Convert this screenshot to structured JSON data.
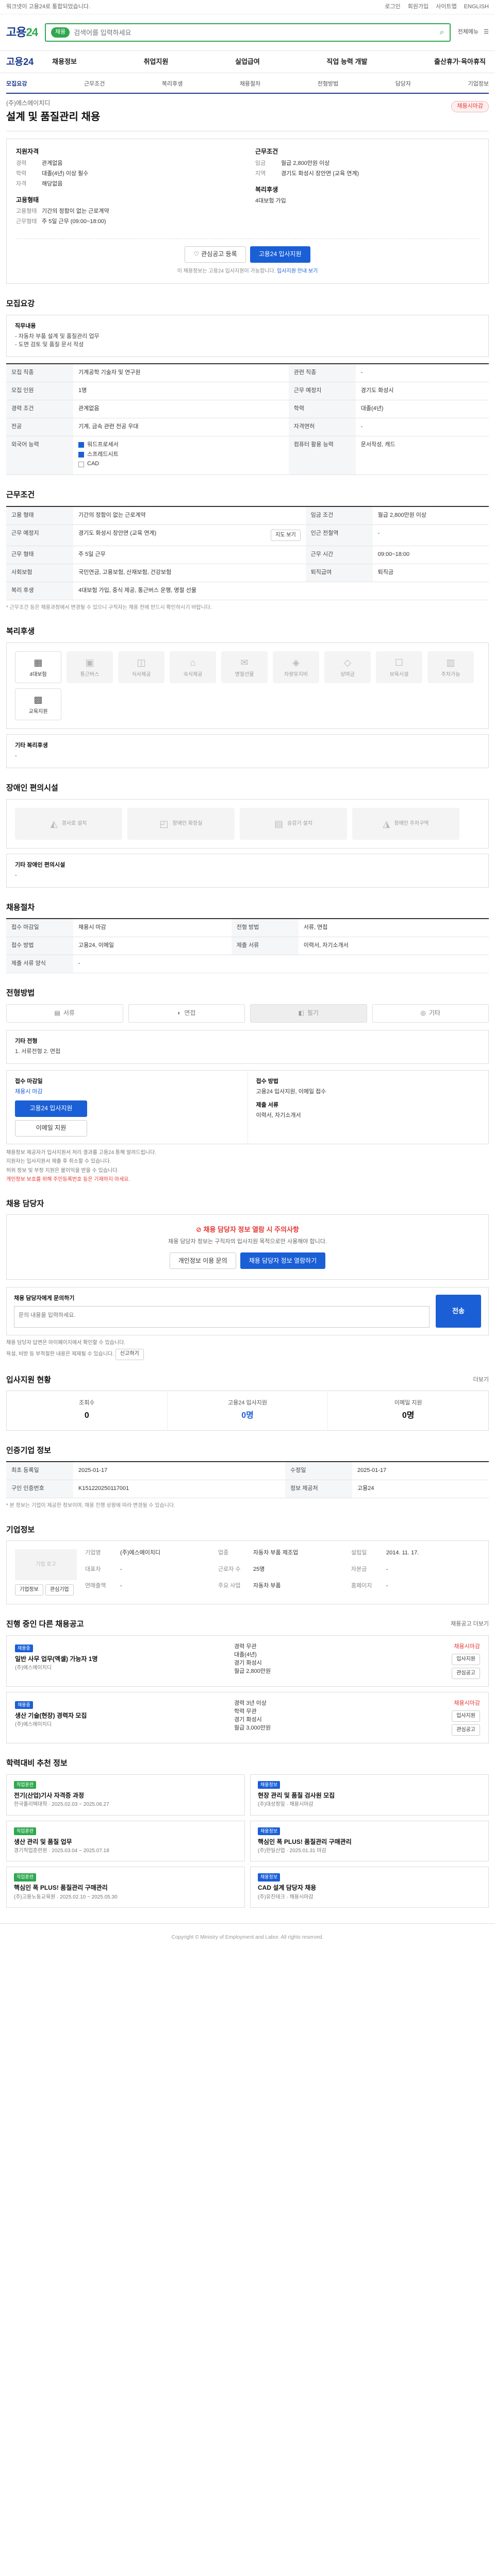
{
  "top": {
    "notice": "워크넷이 고용24로 통합되었습니다.",
    "links": [
      "로그인",
      "회원가입",
      "사이트맵",
      "ENGLISH"
    ]
  },
  "header": {
    "logo_main": "고용",
    "logo_accent": "24",
    "search_pill": "채용",
    "search_placeholder": "검색어를 입력하세요",
    "right": [
      "전체메뉴"
    ]
  },
  "gnb": {
    "brand": "고용24",
    "menu": [
      "채용정보",
      "취업지원",
      "실업급여",
      "직업 능력 개발",
      "출산휴가·육아휴직"
    ]
  },
  "subtabs": [
    "모집요강",
    "근무조건",
    "복리후생",
    "채용절차",
    "전형방법",
    "담당자",
    "기업정보"
  ],
  "title": {
    "company": "(주)에스에이치디",
    "heading": "설계 및 품질관리 채용",
    "dday": "채용시마감"
  },
  "summary": {
    "recruit_title": "지원자격",
    "recruit": [
      {
        "k": "경력",
        "v": "관계없음"
      },
      {
        "k": "학력",
        "v": "대졸(4년) 이상 필수"
      },
      {
        "k": "자격",
        "v": "해당없음"
      }
    ],
    "work_title": "근무조건",
    "work": [
      {
        "k": "임금",
        "v": "월급 2,800만원 이상"
      },
      {
        "k": "지역",
        "v": "경기도 화성시 장안면 (교육 연계)"
      }
    ],
    "type_title": "고용형태",
    "type": [
      {
        "k": "고용형태",
        "v": "기간의 정함이 없는 근로계약"
      },
      {
        "k": "근무형태",
        "v": "주 5일 근무 (09:00~18:00)"
      }
    ],
    "welfare_title": "복리후생",
    "welfare": [
      {
        "k": "",
        "v": "4대보험 가입"
      }
    ],
    "btn_scrap": "관심공고 등록",
    "btn_apply": "고용24 입사지원",
    "note_a": "이 채용정보는 고용24 입사지원이 가능합니다.",
    "note_b": "입사지원 안내 보기"
  },
  "sections": {
    "recruit": {
      "title": "모집요강",
      "duty_label": "직무내용",
      "duty_text": "- 자동차 부품 설계 및 품질관리 업무\n- 도면 검토 및 품질 문서 작성",
      "rows": [
        {
          "k": "모집 직종",
          "v": "기계공학 기술자 및 연구원",
          "k2": "관련 직종",
          "v2": "-"
        },
        {
          "k": "모집 인원",
          "v": "1명",
          "k2": "근무 예정지",
          "v2": "경기도 화성시"
        },
        {
          "k": "경력 조건",
          "v": "관계없음",
          "k2": "학력",
          "v2": "대졸(4년)"
        },
        {
          "k": "전공",
          "v": "기계, 금속 관련 전공 우대",
          "k2": "자격면허",
          "v2": "-"
        },
        {
          "k": "외국어 능력",
          "v": "-",
          "k2": "컴퓨터 활용 능력",
          "v2": "문서작성, 캐드"
        }
      ],
      "checks": [
        "워드프로세서",
        "스프레드시트",
        "CAD"
      ]
    },
    "work": {
      "title": "근무조건",
      "rows": [
        {
          "k": "고용 형태",
          "v": "기간의 정함이 없는 근로계약",
          "k2": "임금 조건",
          "v2": "월급 2,800만원 이상"
        },
        {
          "k": "근무 예정지",
          "v": "경기도 화성시 장안면 (교육 연계)",
          "k2": "인근 전철역",
          "v2": "-"
        },
        {
          "k": "근무 형태",
          "v": "주 5일 근무",
          "k2": "근무 시간",
          "v2": "09:00~18:00"
        },
        {
          "k": "사회보험",
          "v": "국민연금, 고용보험, 산재보험, 건강보험",
          "k2": "퇴직급여",
          "v2": "퇴직금"
        },
        {
          "k": "복리 후생",
          "v": "4대보험 가입, 중식 제공, 통근버스 운행, 명절 선물",
          "k2": "",
          "v2": ""
        }
      ],
      "map_btn": "지도 보기",
      "footnote": "* 근무조건 등은 채용과정에서 변경될 수 있으니 구직자는 채용 전에 반드시 확인하시기 바랍니다."
    },
    "welfare": {
      "title": "복리후생",
      "items": [
        {
          "icon": "building-icon",
          "glyph": "▦",
          "label": "4대보험",
          "on": true
        },
        {
          "icon": "bus-icon",
          "glyph": "▣",
          "label": "통근버스",
          "on": false
        },
        {
          "icon": "meal-icon",
          "glyph": "◫",
          "label": "식사제공",
          "on": false
        },
        {
          "icon": "home-icon",
          "glyph": "⌂",
          "label": "숙식제공",
          "on": false
        },
        {
          "icon": "gift-icon",
          "glyph": "✉",
          "label": "명절선물",
          "on": false
        },
        {
          "icon": "car-icon",
          "glyph": "◈",
          "label": "차량유지비",
          "on": false
        },
        {
          "icon": "bonus-icon",
          "glyph": "◇",
          "label": "상여금",
          "on": false
        },
        {
          "icon": "child-icon",
          "glyph": "☐",
          "label": "보육시설",
          "on": false
        },
        {
          "icon": "parking-icon",
          "glyph": "▥",
          "label": "주차가능",
          "on": false
        },
        {
          "icon": "training-icon",
          "glyph": "▩",
          "label": "교육지원",
          "on": true
        }
      ],
      "etc_label": "기타 복리후생",
      "etc_text": "-"
    },
    "disabled": {
      "title": "장애인 편의시설",
      "items": [
        {
          "icon": "ramp-icon",
          "glyph": "◭",
          "label": "경사로 설치"
        },
        {
          "icon": "toilet-icon",
          "glyph": "◰",
          "label": "장애인 화장실"
        },
        {
          "icon": "elevator-icon",
          "glyph": "▤",
          "label": "승강기 설치"
        },
        {
          "icon": "parking-icon",
          "glyph": "◮",
          "label": "장애인 주차구역"
        }
      ],
      "etc_label": "기타 장애인 편의시설",
      "etc_text": "-"
    },
    "process": {
      "title": "채용절차",
      "rows": [
        {
          "k": "접수 마감일",
          "v": "채용시 마감",
          "k2": "전형 방법",
          "v2": "서류, 면접"
        },
        {
          "k": "접수 방법",
          "v": "고용24, 이메일",
          "k2": "제출 서류",
          "v2": "이력서, 자기소개서"
        },
        {
          "k": "제출 서류 양식",
          "v": "-",
          "k2": "",
          "v2": ""
        }
      ]
    },
    "method": {
      "title": "전형방법",
      "methods": [
        {
          "icon": "doc-icon",
          "glyph": "▤",
          "label": "서류"
        },
        {
          "icon": "person-icon",
          "glyph": "◐",
          "label": "면접"
        },
        {
          "icon": "test-icon",
          "glyph": "◧",
          "label": "필기"
        },
        {
          "icon": "etc-icon",
          "glyph": "◎",
          "label": "기타"
        }
      ],
      "etc_label": "기타 전형",
      "etc_text": "1. 서류전형  2. 면접",
      "apply_title": "접수 마감일",
      "apply_date": "채용시 마감",
      "apply_btn": "고용24 입사지원",
      "email_btn": "이메일 지원",
      "submit_title": "접수 방법",
      "submit_text": "고용24 입사지원, 이메일 접수",
      "docs_title": "제출 서류",
      "docs_text": "이력서, 자기소개서",
      "bullets": [
        "채용정보 제공자가 입사지원서 처리 결과를 고용24 통해 알려드립니다.",
        "지원자는 입사지원서 제출 후 취소할 수 있습니다.",
        "허위 정보 및 부정 지원은 불이익을 받을 수 있습니다."
      ],
      "bullet_red": "개인정보 보호를 위해 주민등록번호 등은 기재하지 마세요."
    },
    "contact": {
      "title": "채용 담당자",
      "warn": "채용 담당자 정보 열람 시 주의사항",
      "desc": "채용 담당자 정보는 구직자의 입사지원 목적으로만 사용해야 합니다.",
      "btn_ask": "개인정보 이용 문의",
      "btn_view": "채용 담당자 정보 열람하기",
      "msg_label": "채용 담당자에게 문의하기",
      "msg_placeholder": "문의 내용을 입력하세요.",
      "send": "전송",
      "notes": [
        "채용 담당자 답변은 마이페이지에서 확인할 수 있습니다.",
        "욕설, 비방 등 부적절한 내용은 제재될 수 있습니다."
      ],
      "report_btn": "신고하기"
    },
    "stats": {
      "title": "입사지원 현황",
      "more": "더보기",
      "items": [
        {
          "t": "조회수",
          "n": "0",
          "blue": false
        },
        {
          "t": "고용24 입사지원",
          "n": "0명",
          "blue": true
        },
        {
          "t": "이메일 지원",
          "n": "0명",
          "blue": false
        }
      ]
    },
    "info": {
      "title": "인증기업 정보",
      "rows": [
        {
          "k": "최초 등록일",
          "v": "2025-01-17",
          "k2": "수정일",
          "v2": "2025-01-17"
        },
        {
          "k": "구인 인증번호",
          "v": "K151220250117001",
          "k2": "정보 제공처",
          "v2": "고용24"
        }
      ],
      "footnote": "* 본 정보는 기업이 제공한 정보이며, 채용 진행 상황에 따라 변경될 수 있습니다."
    },
    "company": {
      "title": "기업정보",
      "logo_alt": "기업 로고",
      "btn_more": "기업정보",
      "btn_scrap": "관심기업",
      "fields": [
        {
          "k": "기업명",
          "v": "(주)에스에이치디"
        },
        {
          "k": "업종",
          "v": "자동차 부품 제조업"
        },
        {
          "k": "설립일",
          "v": "2014. 11. 17."
        },
        {
          "k": "대표자",
          "v": "-"
        },
        {
          "k": "근로자 수",
          "v": "25명"
        },
        {
          "k": "자본금",
          "v": "-"
        },
        {
          "k": "연매출액",
          "v": "-"
        },
        {
          "k": "주요 사업",
          "v": "자동차 부품"
        },
        {
          "k": "홈페이지",
          "v": "-"
        }
      ]
    },
    "others": {
      "title": "진행 중인 다른 채용공고",
      "more": "채용공고 더보기",
      "items": [
        {
          "badge": "채용중",
          "title": "일반 사무 업무(엑셀) 가능자 1명",
          "company": "(주)에스에이치디",
          "meta": [
            "경력 무관",
            "대졸(4년)",
            "경기 화성시"
          ],
          "pay": "월급 2,800만원",
          "dday": "채용시마감",
          "btn_apply": "입사지원",
          "btn_scrap": "관심공고"
        },
        {
          "badge": "채용중",
          "title": "생산 기술(현장) 경력자 모집",
          "company": "(주)에스에이치디",
          "meta": [
            "경력 3년 이상",
            "학력 무관",
            "경기 화성시"
          ],
          "pay": "월급 3,000만원",
          "dday": "채용시마감",
          "btn_apply": "입사지원",
          "btn_scrap": "관심공고"
        }
      ]
    },
    "reco": {
      "title": "학력대비 추천 정보",
      "items": [
        {
          "badge": "직업훈련",
          "blue": false,
          "title": "전기(산업)기사 자격증 과정",
          "meta": "한국폴리텍대학 · 2025.02.03 ~ 2025.06.27"
        },
        {
          "badge": "채용정보",
          "blue": true,
          "title": "현장 관리 및 품질 검사원 모집",
          "meta": "(주)대성정밀 · 채용시마감"
        },
        {
          "badge": "직업훈련",
          "blue": false,
          "title": "생산 관리 및 품질 업무",
          "meta": "경기직업훈련원 · 2025.03.04 ~ 2025.07.18"
        },
        {
          "badge": "채용정보",
          "blue": true,
          "title": "핵심인 폭 PLUS! 품질관리 구매관리",
          "meta": "(주)한일산업 · 2025.01.31 마감"
        },
        {
          "badge": "직업훈련",
          "blue": false,
          "title": "핵심인 폭 PLUS! 품질관리 구매관리",
          "meta": "(주)고용노동교육원 · 2025.02.10 ~ 2025.05.30"
        },
        {
          "badge": "채용정보",
          "blue": true,
          "title": "CAD 설계 담당자 채용",
          "meta": "(주)유진테크 · 채용시마감"
        }
      ]
    }
  },
  "footer": "Copyright © Ministry of Employment and Labor. All rights reserved."
}
